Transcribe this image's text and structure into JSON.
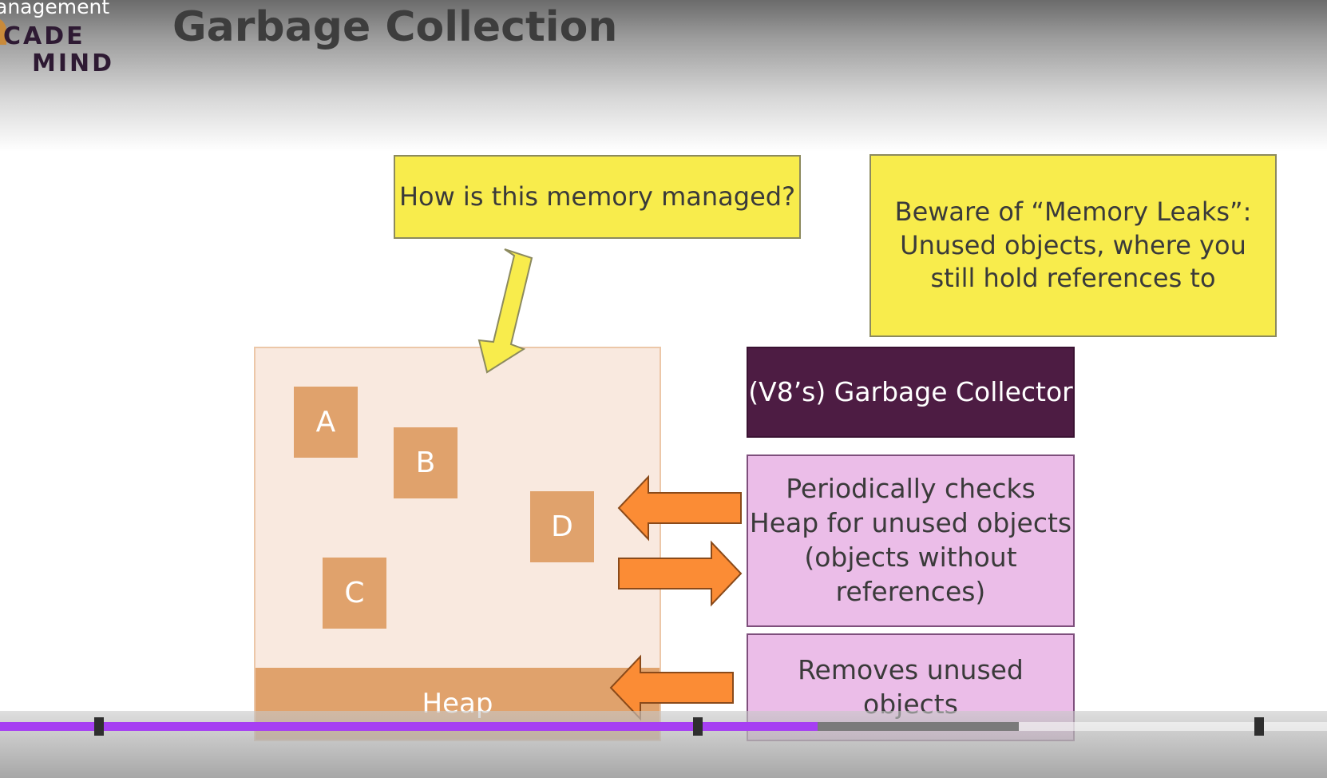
{
  "player": {
    "video_title": "anagement",
    "progress_played_fraction": 0.616,
    "progress_buffered_fraction": 0.768,
    "colors": {
      "played": "#a63ff2",
      "buffered": "#7a7a7a",
      "track": "#ffffff"
    }
  },
  "logo": {
    "line1": "CADE",
    "line2": "MIND"
  },
  "slide": {
    "title": "Garbage Collection",
    "question": "How is this memory managed?",
    "leak_warning": "Beware of “Memory Leaks”: Unused objects, where you still hold references to",
    "heap_label": "Heap",
    "objects": [
      "A",
      "B",
      "C",
      "D"
    ],
    "gc_title": "(V8’s) Garbage Collector",
    "gc_checks": "Periodically checks Heap for unused objects (objects without references)",
    "gc_removes": "Removes unused objects",
    "colors": {
      "yellow": "#f8ec4c",
      "heap_bg": "#f9e9df",
      "heap_object": "#e0a26c",
      "gc_dark": "#4d1c43",
      "gc_pink": "#ebbde8",
      "arrow_orange": "#fb8c35"
    }
  }
}
